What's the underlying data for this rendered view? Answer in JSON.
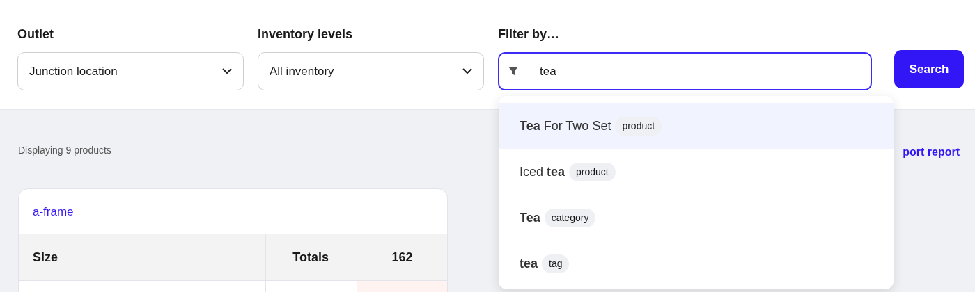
{
  "filters": [
    {
      "label": "Outlet",
      "value": "Junction location"
    },
    {
      "label": "Inventory levels",
      "value": "All inventory"
    }
  ],
  "filter_by": {
    "label": "Filter by…",
    "value": "tea"
  },
  "search_button": "Search",
  "suggestions": [
    {
      "label": "**Tea** For Two Set",
      "tag": "product",
      "selected": true
    },
    {
      "label": "Iced **tea**",
      "tag": "product",
      "selected": false
    },
    {
      "label": "**Tea**",
      "tag": "category",
      "selected": false
    },
    {
      "label": "**tea**",
      "tag": "tag",
      "selected": false
    }
  ],
  "results_count": "Displaying 9 products",
  "export_link": "port report",
  "product_card": {
    "title": "a-frame",
    "columns": [
      "Size",
      "Totals",
      "162"
    ]
  }
}
